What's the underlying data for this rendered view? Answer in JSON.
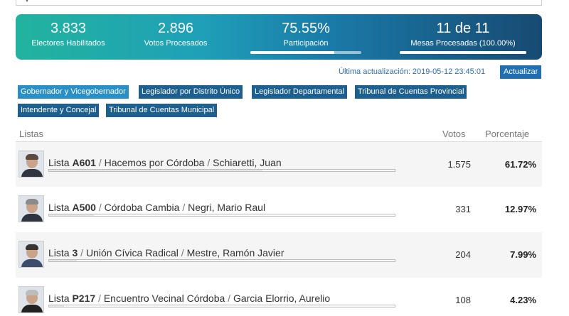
{
  "stats": {
    "electores": {
      "value": "3.833",
      "label": "Electores Habilitados"
    },
    "votos": {
      "value": "2.896",
      "label": "Votos Procesados"
    },
    "participacion": {
      "value": "75.55%",
      "label": "Participación",
      "fraction": 0.7555
    },
    "mesas": {
      "value": "11 de 11",
      "label": "Mesas Procesadas (100.00%)",
      "fraction": 1.0
    }
  },
  "update": {
    "text": "Última actualización: 2019-05-12 23:45:01",
    "button": "Actualizar"
  },
  "tabs": [
    "Gobernador y Vicegobernador",
    "Legislador por Distrito Único",
    "Legislador Departamental",
    "Tribunal de Cuentas Provincial",
    "Intendente y Concejal",
    "Tribunal de Cuentas Municipal"
  ],
  "table": {
    "headers": {
      "listas": "Listas",
      "votos": "Votos",
      "porcentaje": "Porcentaje"
    },
    "separator": " / ",
    "rows": [
      {
        "prefix": "Lista ",
        "code": "A601",
        "party": "Hacemos por Córdoba",
        "candidate": "Schiaretti, Juan",
        "votes": "1.575",
        "pct": "61.72%",
        "share": 0.6172
      },
      {
        "prefix": "Lista ",
        "code": "A500",
        "party": "Córdoba Cambia",
        "candidate": "Negri, Mario Raul",
        "votes": "331",
        "pct": "12.97%",
        "share": 0.1297
      },
      {
        "prefix": "Lista ",
        "code": "3",
        "party": "Unión Cívica Radical",
        "candidate": "Mestre, Ramón Javier",
        "votes": "204",
        "pct": "7.99%",
        "share": 0.0799
      },
      {
        "prefix": "Lista ",
        "code": "P217",
        "party": "Encuentro Vecinal Córdoba",
        "candidate": "Garcia Elorrio, Aurelio",
        "votes": "108",
        "pct": "4.23%",
        "share": 0.0423
      }
    ]
  },
  "colors": {
    "accent": "#1f6fb2",
    "tab": "#1d5f8f",
    "tab_active": "#2a8fc4"
  }
}
